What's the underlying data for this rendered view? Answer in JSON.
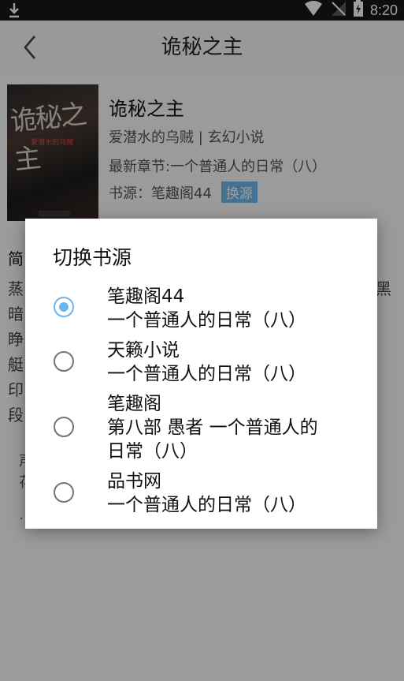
{
  "status_bar": {
    "time": "8:20"
  },
  "app_bar": {
    "title": "诡秘之主"
  },
  "book": {
    "title": "诡秘之主",
    "meta": "爱潜水的乌贼 | 玄幻小说",
    "latest": "最新章节:一个普通人的日常（八）",
    "source_label": "书源：笔趣阁44",
    "switch_label": "换源"
  },
  "intro": {
    "heading": "简",
    "lines": [
      "蒸",
      "暗",
      "睁",
      "艇",
      "印",
      "段"
    ],
    "line_end": "黑"
  },
  "toc": [
    "声",
    "花",
    "…"
  ],
  "dialog": {
    "title": "切换书源",
    "options": [
      {
        "name": "笔趣阁44",
        "chapter": "一个普通人的日常（八）",
        "selected": true
      },
      {
        "name": "天籁小说",
        "chapter": "一个普通人的日常（八）",
        "selected": false
      },
      {
        "name": "笔趣阁",
        "chapter_line1": "第八部 愚者 一个普通人的",
        "chapter_line2": "日常（八）",
        "selected": false
      },
      {
        "name": "品书网",
        "chapter": "一个普通人的日常（八）",
        "selected": false
      }
    ]
  },
  "colors": {
    "accent": "#6cb6ee",
    "scrim": "rgba(0,0,0,0.38)"
  }
}
